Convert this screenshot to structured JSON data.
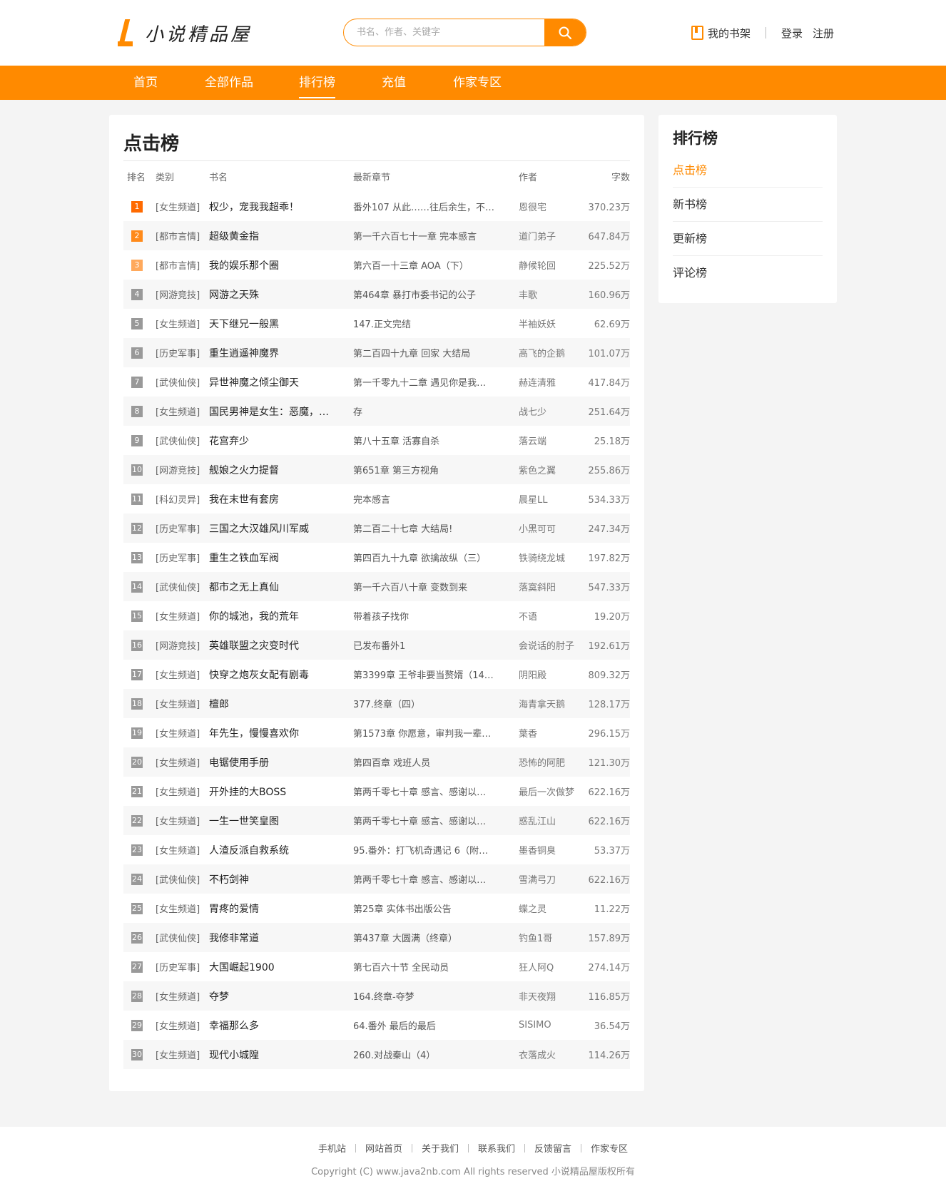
{
  "site": {
    "name": "小说精品屋"
  },
  "search": {
    "placeholder": "书名、作者、关键字"
  },
  "user": {
    "shelf": "我的书架",
    "login": "登录",
    "register": "注册"
  },
  "nav": [
    {
      "label": "首页"
    },
    {
      "label": "全部作品"
    },
    {
      "label": "排行榜",
      "active": true
    },
    {
      "label": "充值"
    },
    {
      "label": "作家专区"
    }
  ],
  "ranking": {
    "title": "点击榜",
    "headers": {
      "rank": "排名",
      "category": "类别",
      "name": "书名",
      "chapter": "最新章节",
      "author": "作者",
      "words": "字数"
    },
    "rows": [
      {
        "rank": "1",
        "category": "[女生频道]",
        "name": "权少，宠我我超乖！",
        "chapter": "番外107 从此……往后余生，不…",
        "author": "恩很宅",
        "words": "370.23万"
      },
      {
        "rank": "2",
        "category": "[都市言情]",
        "name": "超级黄金指",
        "chapter": "第一千六百七十一章 完本感言",
        "author": "道门弟子",
        "words": "647.84万"
      },
      {
        "rank": "3",
        "category": "[都市言情]",
        "name": "我的娱乐那个圈",
        "chapter": "第六百一十三章 AOA（下）",
        "author": "静候轮回",
        "words": "225.52万"
      },
      {
        "rank": "4",
        "category": "[网游竞技]",
        "name": "网游之天殊",
        "chapter": "第464章 暴打市委书记的公子",
        "author": "丰歌",
        "words": "160.96万"
      },
      {
        "rank": "5",
        "category": "[女生频道]",
        "name": "天下继兄一般黑",
        "chapter": "147.正文完结",
        "author": "半袖妖妖",
        "words": "62.69万"
      },
      {
        "rank": "6",
        "category": "[历史军事]",
        "name": "重生逍遥神魔界",
        "chapter": "第二百四十九章 回家 大结局",
        "author": "高飞的企鹅",
        "words": "101.07万"
      },
      {
        "rank": "7",
        "category": "[武侠仙侠]",
        "name": "异世神魔之倾尘御天",
        "chapter": "第一千零九十二章 遇见你是我…",
        "author": "赫连清雅",
        "words": "417.84万"
      },
      {
        "rank": "8",
        "category": "[女生频道]",
        "name": "国民男神是女生：恶魔，…",
        "chapter": "存",
        "author": "战七少",
        "words": "251.64万"
      },
      {
        "rank": "9",
        "category": "[武侠仙侠]",
        "name": "花宫弃少",
        "chapter": "第八十五章 活寡自杀",
        "author": "落云端",
        "words": "25.18万"
      },
      {
        "rank": "10",
        "category": "[网游竞技]",
        "name": "舰娘之火力提督",
        "chapter": "第651章 第三方视角",
        "author": "紫色之翼",
        "words": "255.86万"
      },
      {
        "rank": "11",
        "category": "[科幻灵异]",
        "name": "我在末世有套房",
        "chapter": "完本感言",
        "author": "晨星LL",
        "words": "534.33万"
      },
      {
        "rank": "12",
        "category": "[历史军事]",
        "name": "三国之大汉雄风川军威",
        "chapter": "第二百二十七章 大结局!",
        "author": "小黑可可",
        "words": "247.34万"
      },
      {
        "rank": "13",
        "category": "[历史军事]",
        "name": "重生之铁血军阀",
        "chapter": "第四百九十九章 欲擒故纵（三）",
        "author": "铁骑绕龙城",
        "words": "197.82万"
      },
      {
        "rank": "14",
        "category": "[武侠仙侠]",
        "name": "都市之无上真仙",
        "chapter": "第一千六百八十章 变数到来",
        "author": "落寞斜阳",
        "words": "547.33万"
      },
      {
        "rank": "15",
        "category": "[女生频道]",
        "name": "你的城池，我的荒年",
        "chapter": "带着孩子找你",
        "author": "不语",
        "words": "19.20万"
      },
      {
        "rank": "16",
        "category": "[网游竞技]",
        "name": "英雄联盟之灾变时代",
        "chapter": "已发布番外1",
        "author": "会说话的肘子",
        "words": "192.61万"
      },
      {
        "rank": "17",
        "category": "[女生频道]",
        "name": "快穿之炮灰女配有剧毒",
        "chapter": "第3399章 王爷非要当赘婿（14…",
        "author": "阴阳殿",
        "words": "809.32万"
      },
      {
        "rank": "18",
        "category": "[女生频道]",
        "name": "檀郎",
        "chapter": "377.终章（四）",
        "author": "海青拿天鹅",
        "words": "128.17万"
      },
      {
        "rank": "19",
        "category": "[女生频道]",
        "name": "年先生，慢慢喜欢你",
        "chapter": "第1573章 你愿意，审判我一辈…",
        "author": "葉香",
        "words": "296.15万"
      },
      {
        "rank": "20",
        "category": "[女生频道]",
        "name": "电锯使用手册",
        "chapter": "第四百章 戏班人员",
        "author": "恐怖的阿肥",
        "words": "121.30万"
      },
      {
        "rank": "21",
        "category": "[女生频道]",
        "name": "开外挂的大BOSS",
        "chapter": "第两千零七十章 感言、感谢以…",
        "author": "最后一次做梦",
        "words": "622.16万"
      },
      {
        "rank": "22",
        "category": "[女生频道]",
        "name": "一生一世笑皇图",
        "chapter": "第两千零七十章 感言、感谢以…",
        "author": "惑乱江山",
        "words": "622.16万"
      },
      {
        "rank": "23",
        "category": "[女生频道]",
        "name": "人渣反派自救系统",
        "chapter": "95.番外：打飞机奇遇记 6（附…",
        "author": "墨香铜臭",
        "words": "53.37万"
      },
      {
        "rank": "24",
        "category": "[武侠仙侠]",
        "name": "不朽剑神",
        "chapter": "第两千零七十章 感言、感谢以…",
        "author": "雪满弓刀",
        "words": "622.16万"
      },
      {
        "rank": "25",
        "category": "[女生频道]",
        "name": "胃疼的爱情",
        "chapter": "第25章 实体书出版公告",
        "author": "蝶之灵",
        "words": "11.22万"
      },
      {
        "rank": "26",
        "category": "[武侠仙侠]",
        "name": "我修非常道",
        "chapter": "第437章 大圆满（终章）",
        "author": "钓鱼1哥",
        "words": "157.89万"
      },
      {
        "rank": "27",
        "category": "[历史军事]",
        "name": "大国崛起1900",
        "chapter": "第七百六十节 全民动员",
        "author": "狂人阿Q",
        "words": "274.14万"
      },
      {
        "rank": "28",
        "category": "[女生频道]",
        "name": "夺梦",
        "chapter": "164.终章-夺梦",
        "author": "非天夜翔",
        "words": "116.85万"
      },
      {
        "rank": "29",
        "category": "[女生频道]",
        "name": "幸福那么多",
        "chapter": "64.番外 最后的最后",
        "author": "SISIMO",
        "words": "36.54万"
      },
      {
        "rank": "30",
        "category": "[女生频道]",
        "name": "现代小城隍",
        "chapter": "260.对战秦山（4）",
        "author": "衣落成火",
        "words": "114.26万"
      }
    ]
  },
  "sidebar": {
    "title": "排行榜",
    "items": [
      {
        "label": "点击榜",
        "active": true
      },
      {
        "label": "新书榜"
      },
      {
        "label": "更新榜"
      },
      {
        "label": "评论榜"
      }
    ]
  },
  "footer": {
    "links": [
      "手机站",
      "网站首页",
      "关于我们",
      "联系我们",
      "反馈留言",
      "作家专区"
    ],
    "copyright": "Copyright (C) www.java2nb.com All rights reserved  小说精品屋版权所有"
  },
  "colors": {
    "accent": "#ff8a00",
    "background": "#f4f4f4"
  },
  "icons": {
    "search": "search-icon",
    "shelf": "bookshelf-icon",
    "logo": "logo-l-mark"
  }
}
